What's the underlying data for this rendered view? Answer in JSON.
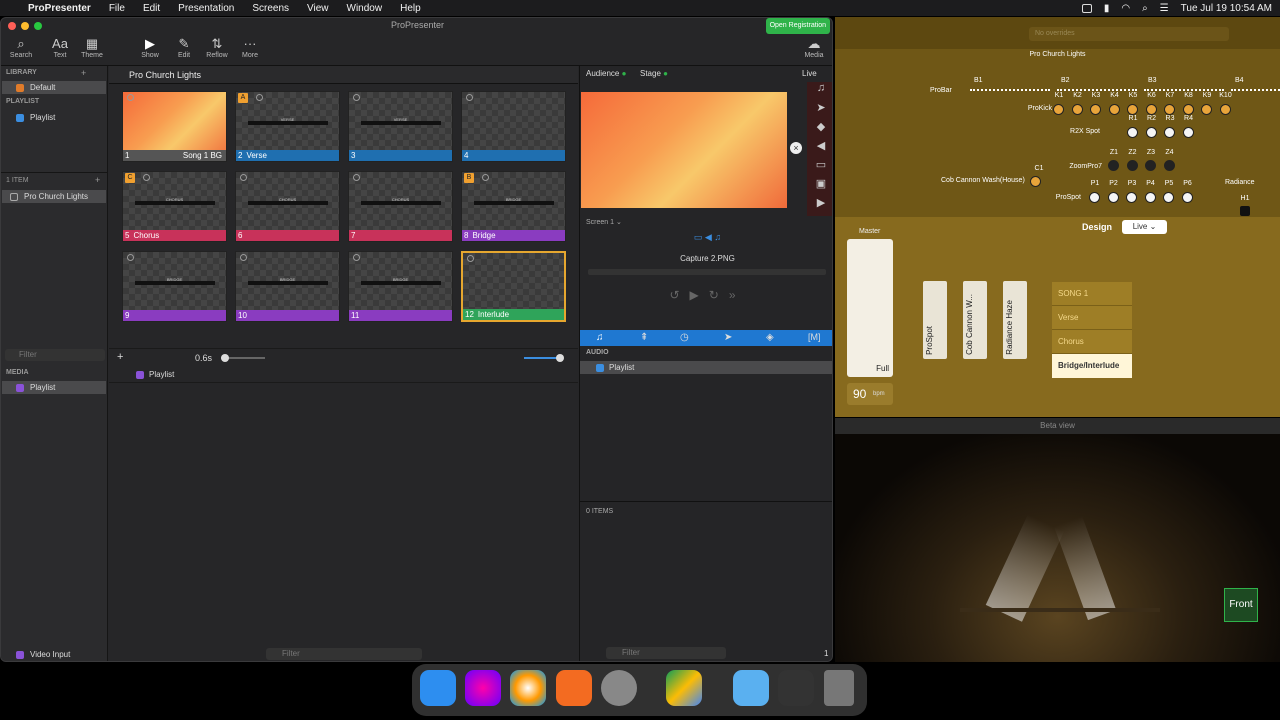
{
  "menubar": {
    "app": "ProPresenter",
    "items": [
      "File",
      "Edit",
      "Presentation",
      "Screens",
      "View",
      "Window",
      "Help"
    ],
    "clock": "Tue Jul 19  10:54 AM"
  },
  "window": {
    "title": "ProPresenter",
    "registration": "Open Registration"
  },
  "toolbar": {
    "search": "Search",
    "text": "Text",
    "theme": "Theme",
    "show": "Show",
    "edit": "Edit",
    "reflow": "Reflow",
    "more": "More",
    "media": "Media"
  },
  "sidebar": {
    "library_header": "LIBRARY",
    "library_item": "Default",
    "playlist_header": "PLAYLIST",
    "playlist_item": "Playlist",
    "items_count": "1 ITEM",
    "presentation": "Pro Church Lights",
    "filter": "Filter",
    "media_header": "MEDIA",
    "media_item": "Playlist",
    "video_input": "Video Input"
  },
  "presentation": {
    "title": "Pro Church Lights",
    "zoom": "0.6s",
    "bottom_playlist": "Playlist",
    "filter": "Filter"
  },
  "slides": [
    {
      "num": "1",
      "label": "Song 1 BG",
      "badge": "",
      "color": "#555555",
      "text": ""
    },
    {
      "num": "2",
      "label": "Verse",
      "badge": "A",
      "color": "#1f6fb0",
      "text": "VERSE"
    },
    {
      "num": "3",
      "label": "",
      "badge": "",
      "color": "#1f6fb0",
      "text": "VERSE"
    },
    {
      "num": "4",
      "label": "",
      "badge": "",
      "color": "#1f6fb0",
      "text": ""
    },
    {
      "num": "5",
      "label": "Chorus",
      "badge": "C",
      "color": "#c8325a",
      "text": "CHORUS"
    },
    {
      "num": "6",
      "label": "",
      "badge": "",
      "color": "#c8325a",
      "text": "CHORUS"
    },
    {
      "num": "7",
      "label": "",
      "badge": "",
      "color": "#c8325a",
      "text": "CHORUS"
    },
    {
      "num": "8",
      "label": "Bridge",
      "badge": "B",
      "color": "#8a3cc0",
      "text": "BRIDGE"
    },
    {
      "num": "9",
      "label": "",
      "badge": "",
      "color": "#8a3cc0",
      "text": "BRIDGE"
    },
    {
      "num": "10",
      "label": "",
      "badge": "",
      "color": "#8a3cc0",
      "text": "BRIDGE"
    },
    {
      "num": "11",
      "label": "",
      "badge": "",
      "color": "#8a3cc0",
      "text": "BRIDGE"
    },
    {
      "num": "12",
      "label": "Interlude",
      "badge": "",
      "color": "#2fa45a",
      "text": ""
    }
  ],
  "output": {
    "audience": "Audience",
    "stage": "Stage",
    "live": "Live",
    "screen": "Screen 1",
    "capture": "Capture 2.PNG",
    "audio_header": "AUDIO",
    "audio_item": "Playlist",
    "items": "0 ITEMS",
    "filter": "Filter",
    "count": "1"
  },
  "lighting": {
    "search_placeholder": "No overrides",
    "title": "Pro Church Lights",
    "groups": [
      "B1",
      "B2",
      "B3",
      "B4"
    ],
    "probar": "ProBar",
    "prokick": "ProKick",
    "r2x": "R2X Spot",
    "zoompro": "ZoomPro7",
    "cob": "Cob Cannon Wash(House)",
    "prospot": "ProSpot",
    "radiance": "Radiance",
    "kicks": [
      "K1",
      "K2",
      "K3",
      "K4",
      "K5",
      "K6",
      "K7",
      "K8",
      "K9",
      "K10"
    ],
    "rs": [
      "R1",
      "R2",
      "R3",
      "R4"
    ],
    "zs": [
      "Z1",
      "Z2",
      "Z3",
      "Z4"
    ],
    "ps": [
      "P1",
      "P2",
      "P3",
      "P4",
      "P5",
      "P6"
    ],
    "c1": "C1",
    "h1": "H1",
    "design": "Design",
    "live": "Live",
    "master": "Master",
    "full": "Full",
    "bpm": "90",
    "bpm_label": "bpm",
    "faders": [
      "ProSpot",
      "Cob Cannon W...",
      "Radiance Haze"
    ],
    "cues": [
      "SONG 1",
      "Verse",
      "Chorus",
      "Bridge/Interlude"
    ]
  },
  "beta": {
    "title": "Beta view",
    "front": "Front"
  }
}
